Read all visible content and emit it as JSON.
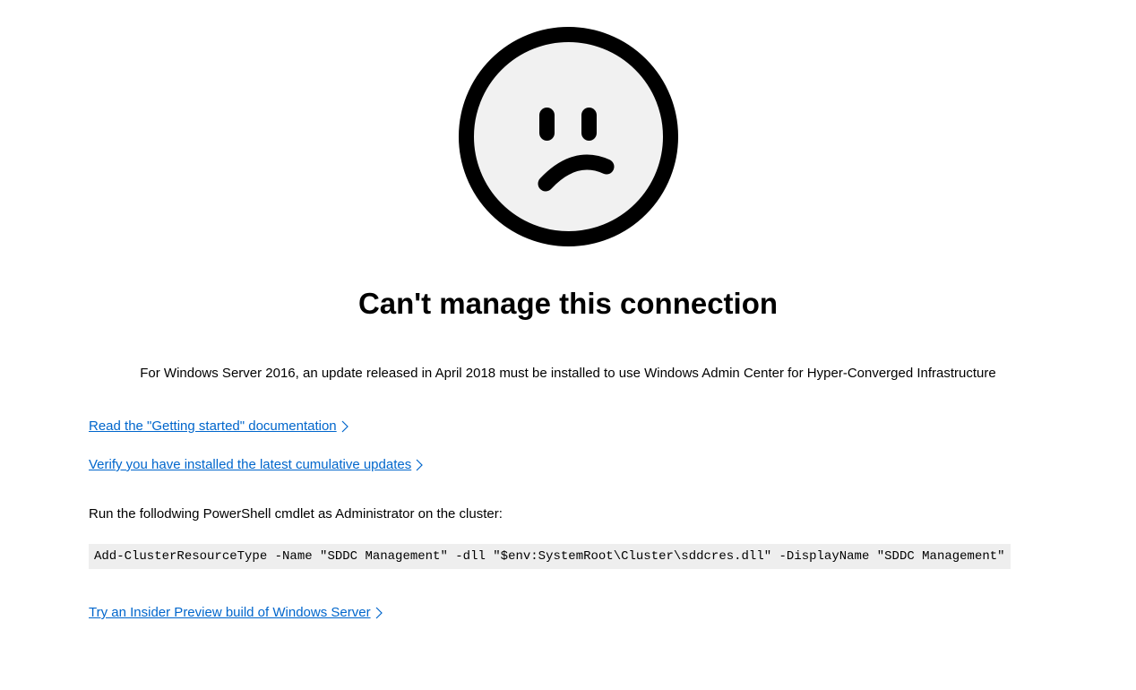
{
  "error": {
    "title": "Can't manage this connection",
    "description": "For Windows Server 2016, an update released in April 2018 must be installed to use Windows Admin Center for Hyper-Converged Infrastructure",
    "link_docs": "Read the \"Getting started\" documentation ",
    "link_updates": "Verify you have installed the latest cumulative updates ",
    "instruction": "Run the follodwing PowerShell cmdlet as Administrator on the cluster:",
    "cmdlet": "Add-ClusterResourceType -Name \"SDDC Management\" -dll \"$env:SystemRoot\\Cluster\\sddcres.dll\" -DisplayName \"SDDC Management\"",
    "link_insider": "Try an Insider Preview build of Windows Server "
  }
}
